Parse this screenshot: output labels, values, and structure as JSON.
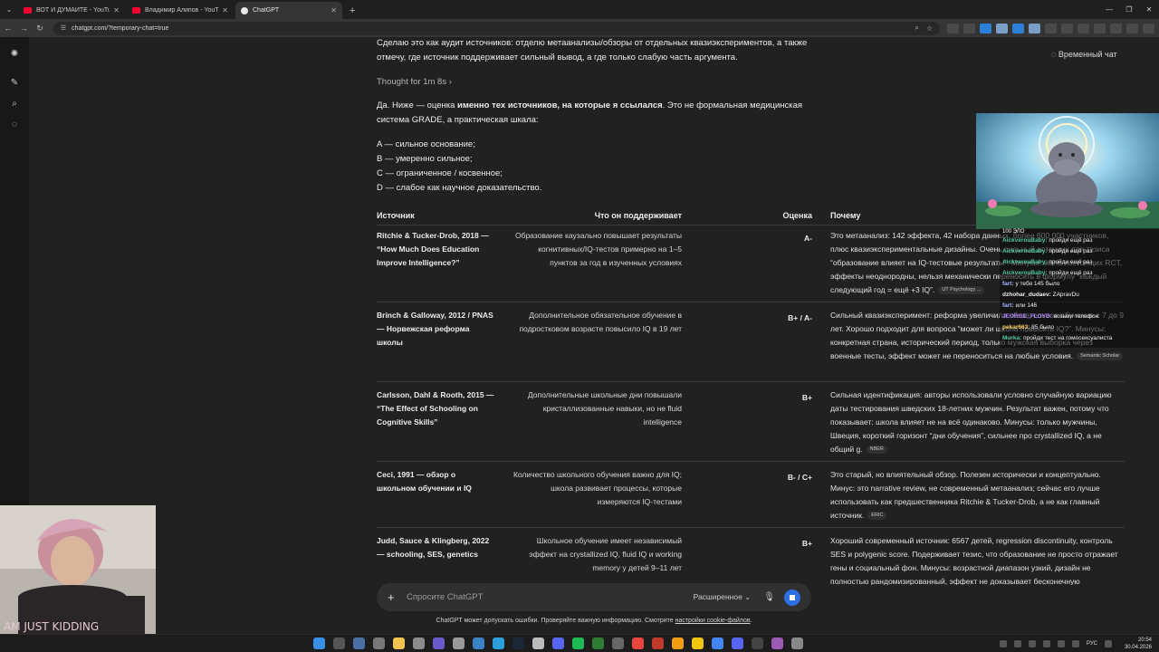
{
  "browser": {
    "tabs": [
      {
        "title": "ВОТ И ДУМАЙТЕ - YouTube",
        "favicon": "youtube-icon"
      },
      {
        "title": "Владимир Алипов - YouTube",
        "favicon": "youtube-icon"
      },
      {
        "title": "ChatGPT",
        "favicon": "chatgpt-icon",
        "active": true
      }
    ],
    "url": "chatgpt.com/?temporary-chat=true"
  },
  "header": {
    "temporary_chat_label": "Временный чат"
  },
  "message": {
    "intro": "Сделаю это как аудит источников: отделю метаанализы/обзоры от отдельных квазиэкспериментов, а также отмечу, где источник поддерживает сильный вывод, а где только слабую часть аргумента.",
    "thought_label": "Thought for 1m 8s",
    "lead_prefix": "Да. Ниже — оценка ",
    "lead_bold": "именно тех источников, на которые я ссылался",
    "lead_suffix": ". Это не формальная медицинская система GRADE, а практическая шкала:",
    "scale": [
      "A — сильное основание;",
      "B — умеренно сильное;",
      "C — ограниченное / косвенное;",
      "D — слабое как научное доказательство."
    ],
    "table": {
      "headers": [
        "Источник",
        "Что он поддерживает",
        "Оценка",
        "Почему"
      ],
      "rows": [
        {
          "source": "Ritchie & Tucker-Drob, 2018 — “How Much Does Education Improve Intelligence?”",
          "supports": "Образование каузально повышает результаты когнитивных/IQ-тестов примерно на 1–5 пунктов за год в изученных условиях",
          "grade": "A-",
          "why": "Это метаанализ: 142 эффекта, 42 набора данных, более 600 000 участников, плюс квазиэкспериментальные дизайны. Очень сильный источник для тезиса “образование влияет на IQ-тестовые результаты”. Минусы: мало настоящих RCT, эффекты неоднородны, нельзя механически переносить в формулу “каждый следующий год = ещё +3 IQ”.",
          "cite": "UT Psychology ..."
        },
        {
          "source": "Brinch & Galloway, 2012 / PNAS — Норвежская реформа школы",
          "supports": "Дополнительное обязательное обучение в подростковом возрасте повысило IQ в 19 лет",
          "grade": "B+ / A-",
          "why": "Сильный квазиэксперимент: реформа увеличила обязательное обучение с 7 до 9 лет. Хорошо подходит для вопроса “может ли школа повысить IQ?”. Минусы: конкретная страна, исторический период, только мужская выборка через военные тесты, эффект может не переноситься на любые условия.",
          "cite": "Semantic Scholar"
        },
        {
          "source": "Carlsson, Dahl & Rooth, 2015 — “The Effect of Schooling on Cognitive Skills”",
          "supports": "Дополнительные школьные дни повышали кристаллизованные навыки, но не fluid intelligence",
          "grade": "B+",
          "why": "Сильная идентификация: авторы использовали условно случайную вариацию даты тестирования шведских 18-летних мужчин. Результат важен, потому что показывает: школа влияет не на всё одинаково. Минусы: только мужчины, Швеция, короткий горизонт “дни обучения”, сильнее про crystallized IQ, а не общий g.",
          "cite": "NBER"
        },
        {
          "source": "Ceci, 1991 — обзор о школьном обучении и IQ",
          "supports": "Количество школьного обучения важно для IQ; школа развивает процессы, которые измеряются IQ-тестами",
          "grade": "B- / C+",
          "why": "Это старый, но влиятельный обзор. Полезен исторически и концептуально. Минус: это narrative review, не современный метаанализ; сейчас его лучше использовать как предшественника Ritchie & Tucker-Drob, а не как главный источник.",
          "cite": "ERIC"
        },
        {
          "source": "Judd, Sauce & Klingberg, 2022 — schooling, SES, genetics",
          "supports": "Школьное обучение имеет независимый эффект на crystallized IQ, fluid IQ и working memory у детей 9–11 лет",
          "grade": "B+",
          "why": "Хороший современный источник: 6567 детей, regression discontinuity, контроль SES и polygenic score. Подерживает тезис, что образование не просто отражает гены и социальный фон. Минусы: возрастной диапазон узкий, дизайн не полностью рандомизированный, эффект не доказывает бесконечную",
          "cite": ""
        }
      ]
    }
  },
  "composer": {
    "placeholder": "Спросите ChatGPT",
    "mode_label": "Расширенное"
  },
  "disclaimer": {
    "text": "ChatGPT может допускать ошибки. Проверяйте важную информацию. Смотрите ",
    "link": "настройки cookie-файлов",
    "end": "."
  },
  "stream_chat": {
    "title": "100 ЭЛО",
    "messages": [
      {
        "user": "AickverouBaby:",
        "text": "пройди ещё раз"
      },
      {
        "user": "AickverouBaby:",
        "text": "пройди ещё раз"
      },
      {
        "user": "AickverouBaby:",
        "text": "пройди ещё раз"
      },
      {
        "user": "AickverouBaby:",
        "text": "пройди ещё раз"
      },
      {
        "user": "fart:",
        "text": "у тебя 145 было"
      },
      {
        "user": "dzhohar_dudaev:",
        "text": "ZApravDu"
      },
      {
        "user": "fart:",
        "text": "или 146"
      },
      {
        "user": "JEORGE_FLOYD:",
        "text": "возьми телефон"
      },
      {
        "user": "pekar663:",
        "text": "85 было"
      },
      {
        "user": "Murka:",
        "text": "пройди тест на гомосексуалиста"
      }
    ]
  },
  "webcam_text": "AM JUST KIDDING",
  "taskbar": {
    "lang": "РУС",
    "time": "20:54",
    "date": "30.04.2026"
  }
}
